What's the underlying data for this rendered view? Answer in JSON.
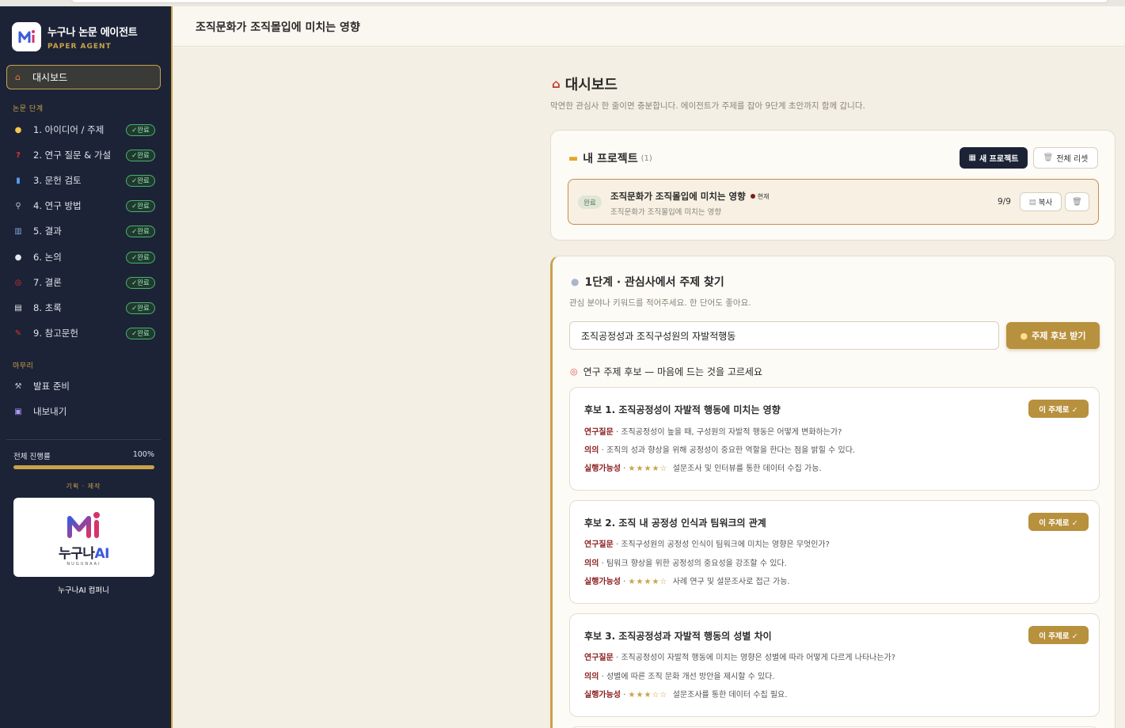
{
  "brand": {
    "title": "누구나 논문 에이전트",
    "subtitle": "PAPER AGENT"
  },
  "sidebar": {
    "dashboard_label": "대시보드",
    "section_steps": "논문 단계",
    "steps": [
      {
        "label": "1. 아이디어 / 주제",
        "badge": "✓완료",
        "icon": "lightbulb-icon"
      },
      {
        "label": "2. 연구 질문 & 가설",
        "badge": "✓완료",
        "icon": "question-icon"
      },
      {
        "label": "3. 문헌 검토",
        "badge": "✓완료",
        "icon": "books-icon"
      },
      {
        "label": "4. 연구 방법",
        "badge": "✓완료",
        "icon": "microscope-icon"
      },
      {
        "label": "5. 결과",
        "badge": "✓완료",
        "icon": "chart-icon"
      },
      {
        "label": "6. 논의",
        "badge": "✓완료",
        "icon": "speech-icon"
      },
      {
        "label": "7. 결론",
        "badge": "✓완료",
        "icon": "target-icon"
      },
      {
        "label": "8. 초록",
        "badge": "✓완료",
        "icon": "document-icon"
      },
      {
        "label": "9. 참고문헌",
        "badge": "✓완료",
        "icon": "pin-icon"
      }
    ],
    "section_finish": "마무리",
    "finish_items": [
      {
        "label": "발표 준비",
        "icon": "hammer-icon"
      },
      {
        "label": "내보내기",
        "icon": "export-icon"
      }
    ],
    "progress_label": "전체 진행률",
    "progress_value": "100%",
    "progress_fraction": 1.0,
    "credit_label": "기획 · 제작",
    "company_word_main": "누구나",
    "company_word_ai": "AI",
    "company_tiny": "NUGUNAAI",
    "company_name": "누구나AI 컴퍼니"
  },
  "header": {
    "title": "조직문화가 조직몰입에 미치는 영향"
  },
  "dashboard": {
    "title": "대시보드",
    "description": "막연한 관심사 한 줄이면 충분합니다. 에이전트가 주제를 잡아 9단계 초안까지 함께 갑니다."
  },
  "projects": {
    "title": "내 프로젝트",
    "count": "(1)",
    "new_button": "새 프로젝트",
    "reset_button": "전체 리셋",
    "items": [
      {
        "status": "완료",
        "name": "조직문화가 조직몰입에 미치는 영향",
        "current": "현재",
        "subtitle": "조직문화가 조직몰입에 미치는 영향",
        "progress": "9/9",
        "copy_button": "복사"
      }
    ]
  },
  "step1": {
    "title": "1단계 · 관심사에서 주제 찾기",
    "description": "관심 분야나 키워드를 적어주세요. 한 단어도 좋아요.",
    "input_value": "조직공정성과 조직구성원의 자발적행동",
    "suggest_button": "주제 후보 받기",
    "candidates_label": "연구 주제 후보 — 마음에 드는 것을 고르세요",
    "pick_label": "이 주제로 ✓",
    "candidates": [
      {
        "title": "후보 1. 조직공정성이 자발적 행동에 미치는 영향",
        "question_tag": "연구질문",
        "question": " · 조직공정성이 높을 때, 구성원의 자발적 행동은 어떻게 변화하는가?",
        "meaning_tag": "의의",
        "meaning": " · 조직의 성과 향상을 위해 공정성이 중요한 역할을 한다는 점을 밝힐 수 있다.",
        "feas_tag": "실행가능성",
        "stars": "★★★★☆",
        "feas": "설문조사 및 인터뷰를 통한 데이터 수집 가능."
      },
      {
        "title": "후보 2. 조직 내 공정성 인식과 팀워크의 관계",
        "question_tag": "연구질문",
        "question": " · 조직구성원의 공정성 인식이 팀워크에 미치는 영향은 무엇인가?",
        "meaning_tag": "의의",
        "meaning": " · 팀워크 향상을 위한 공정성의 중요성을 강조할 수 있다.",
        "feas_tag": "실행가능성",
        "stars": "★★★★☆",
        "feas": "사례 연구 및 설문조사로 접근 가능."
      },
      {
        "title": "후보 3. 조직공정성과 자발적 행동의 성별 차이",
        "question_tag": "연구질문",
        "question": " · 조직공정성이 자발적 행동에 미치는 영향은 성별에 따라 어떻게 다르게 나타나는가?",
        "meaning_tag": "의의",
        "meaning": " · 성별에 따른 조직 문화 개선 방안을 제시할 수 있다.",
        "feas_tag": "실행가능성",
        "stars": "★★★☆☆",
        "feas": "설문조사를 통한 데이터 수집 필요."
      }
    ]
  },
  "colors": {
    "sidebar_bg": "#1c2336",
    "accent_gold": "#c9a24a",
    "badge_green": "#4caf72",
    "tag_red": "#8b1e1e"
  }
}
